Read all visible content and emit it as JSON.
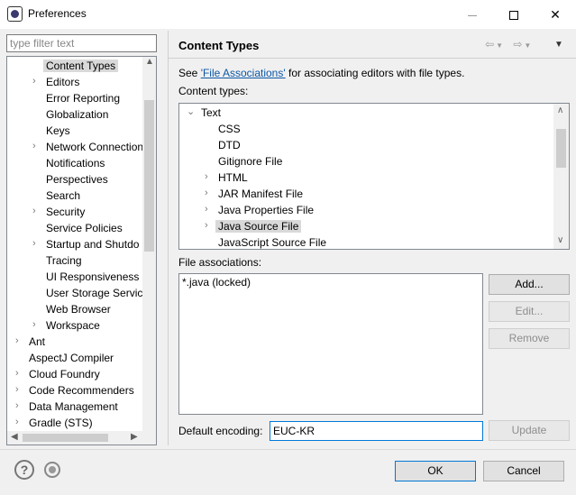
{
  "window": {
    "title": "Preferences"
  },
  "filter": {
    "placeholder": "type filter text"
  },
  "nav_tree": {
    "items": [
      {
        "label": "Content Types",
        "selected": true,
        "expandable": false
      },
      {
        "label": "Editors",
        "expandable": true
      },
      {
        "label": "Error Reporting",
        "expandable": false
      },
      {
        "label": "Globalization",
        "expandable": false
      },
      {
        "label": "Keys",
        "expandable": false
      },
      {
        "label": "Network Connection",
        "expandable": true
      },
      {
        "label": "Notifications",
        "expandable": false
      },
      {
        "label": "Perspectives",
        "expandable": false
      },
      {
        "label": "Search",
        "expandable": false
      },
      {
        "label": "Security",
        "expandable": true
      },
      {
        "label": "Service Policies",
        "expandable": false
      },
      {
        "label": "Startup and Shutdo",
        "expandable": true
      },
      {
        "label": "Tracing",
        "expandable": false
      },
      {
        "label": "UI Responsiveness M",
        "expandable": false
      },
      {
        "label": "User Storage Service",
        "expandable": false
      },
      {
        "label": "Web Browser",
        "expandable": false
      },
      {
        "label": "Workspace",
        "expandable": true
      },
      {
        "label": "Ant",
        "expandable": true
      },
      {
        "label": "AspectJ Compiler",
        "expandable": false
      },
      {
        "label": "Cloud Foundry",
        "expandable": true
      },
      {
        "label": "Code Recommenders",
        "expandable": true
      },
      {
        "label": "Data Management",
        "expandable": true
      },
      {
        "label": "Gradle (STS)",
        "expandable": true
      }
    ]
  },
  "page": {
    "title": "Content Types",
    "see_prefix": "See ",
    "see_link": "'File Associations'",
    "see_suffix": " for associating editors with file types.",
    "content_types_label": "Content types:",
    "file_assoc_label": "File associations:",
    "encoding_label": "Default encoding:"
  },
  "content_types": {
    "root": "Text",
    "items": [
      {
        "label": "CSS",
        "expandable": false
      },
      {
        "label": "DTD",
        "expandable": false
      },
      {
        "label": "Gitignore File",
        "expandable": false
      },
      {
        "label": "HTML",
        "expandable": true
      },
      {
        "label": "JAR Manifest File",
        "expandable": true
      },
      {
        "label": "Java Properties File",
        "expandable": true
      },
      {
        "label": "Java Source File",
        "expandable": true,
        "selected": true
      },
      {
        "label": "JavaScript Source File",
        "expandable": false
      }
    ]
  },
  "file_associations": {
    "items": [
      "*.java (locked)"
    ]
  },
  "buttons": {
    "add": "Add...",
    "edit": "Edit...",
    "remove": "Remove",
    "update": "Update",
    "ok": "OK",
    "cancel": "Cancel"
  },
  "encoding": {
    "value": "EUC-KR"
  }
}
